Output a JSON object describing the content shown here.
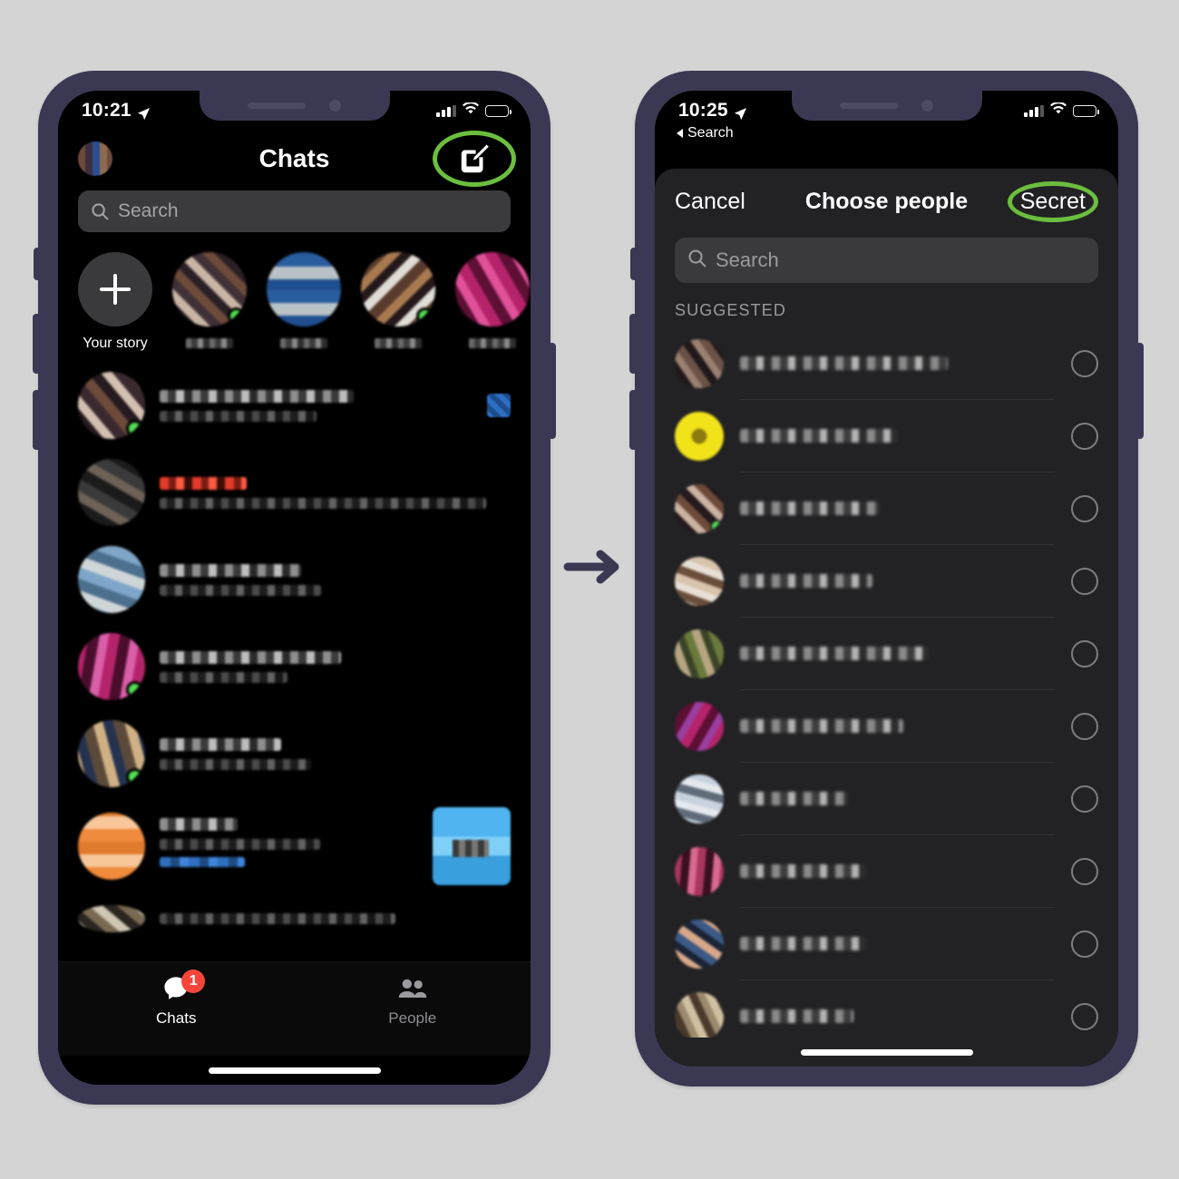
{
  "background_color": "#d4d4d4",
  "frame_color": "#3a3852",
  "highlight_color": "#6cbe3e",
  "accent_blue": "#2d6fbe",
  "badge_color": "#f5453a",
  "online_color": "#52e052",
  "flow": {
    "arrow_icon": "right-arrow-icon",
    "arrow_color": "#3a3852"
  },
  "left_phone": {
    "status_bar": {
      "time": "10:21",
      "location_icon": "location-arrow-icon",
      "signal_icon": "cellular-bars-icon",
      "wifi_icon": "wifi-icon",
      "battery_icon": "battery-low-icon",
      "battery_level_pct": 22
    },
    "header": {
      "title": "Chats",
      "avatar_icon": "profile-avatar",
      "compose_icon": "compose-pencil-icon",
      "compose_highlighted": true
    },
    "search": {
      "placeholder": "Search",
      "icon": "search-icon"
    },
    "stories": {
      "add_label": "Your story",
      "add_icon": "plus-icon",
      "items": [
        {
          "name": "",
          "redacted": true,
          "online": true
        },
        {
          "name": "",
          "redacted": true,
          "online": false
        },
        {
          "name": "",
          "redacted": true,
          "online": true
        },
        {
          "name": "",
          "redacted": true,
          "online": false
        }
      ]
    },
    "chats": [
      {
        "name": "",
        "preview": "",
        "redacted": true,
        "online": true,
        "trailing": "mini-thumb"
      },
      {
        "name": "",
        "preview": "",
        "redacted": true,
        "online": false,
        "trailing": "none",
        "accent": "red"
      },
      {
        "name": "",
        "preview": "",
        "redacted": true,
        "online": false,
        "trailing": "none"
      },
      {
        "name": "",
        "preview": "",
        "redacted": true,
        "online": true,
        "trailing": "none"
      },
      {
        "name": "",
        "preview": "",
        "redacted": true,
        "online": true,
        "trailing": "none"
      },
      {
        "name": "",
        "preview": "",
        "redacted": true,
        "online": false,
        "trailing": "media",
        "accent": "blue"
      }
    ],
    "tab_bar": {
      "tabs": [
        {
          "label": "Chats",
          "icon": "chat-bubble-icon",
          "active": true,
          "badge": "1"
        },
        {
          "label": "People",
          "icon": "people-icon",
          "active": false,
          "badge": ""
        }
      ]
    },
    "home_indicator": true
  },
  "right_phone": {
    "status_bar": {
      "time": "10:25",
      "location_icon": "location-arrow-icon",
      "signal_icon": "cellular-bars-icon",
      "wifi_icon": "wifi-icon",
      "battery_icon": "battery-low-icon",
      "battery_level_pct": 22
    },
    "back_to_app": {
      "label": "Search",
      "icon": "back-caret-icon"
    },
    "sheet": {
      "cancel_label": "Cancel",
      "title": "Choose people",
      "secret_label": "Secret",
      "secret_highlighted": true,
      "search": {
        "placeholder": "Search",
        "icon": "search-icon"
      },
      "section_label": "SUGGESTED",
      "people": [
        {
          "name": "",
          "redacted": true,
          "selected": false,
          "online": false
        },
        {
          "name": "",
          "redacted": true,
          "selected": false,
          "online": false
        },
        {
          "name": "",
          "redacted": true,
          "selected": false,
          "online": true
        },
        {
          "name": "",
          "redacted": true,
          "selected": false,
          "online": false
        },
        {
          "name": "",
          "redacted": true,
          "selected": false,
          "online": false
        },
        {
          "name": "",
          "redacted": true,
          "selected": false,
          "online": false
        },
        {
          "name": "",
          "redacted": true,
          "selected": false,
          "online": false
        },
        {
          "name": "",
          "redacted": true,
          "selected": false,
          "online": false
        },
        {
          "name": "",
          "redacted": true,
          "selected": false,
          "online": false
        },
        {
          "name": "",
          "redacted": true,
          "selected": false,
          "online": false
        }
      ]
    },
    "home_indicator": true
  }
}
